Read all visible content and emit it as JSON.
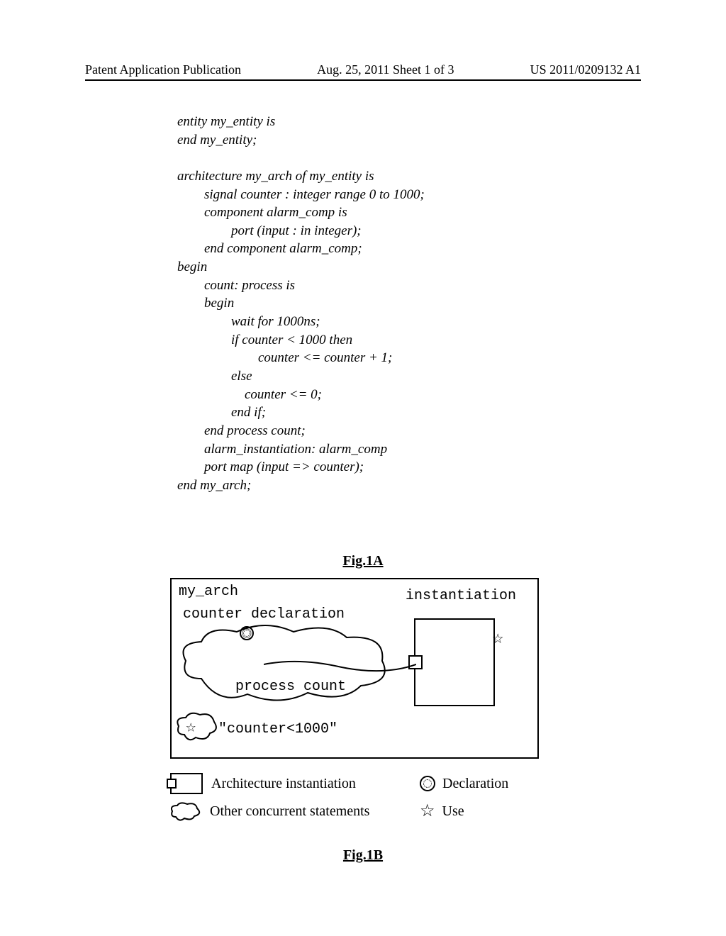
{
  "header": {
    "left": "Patent Application Publication",
    "center": "Aug. 25, 2011  Sheet 1 of 3",
    "right": "US 2011/0209132 A1"
  },
  "code": {
    "lines": [
      "entity my_entity is",
      "end my_entity;",
      "",
      "architecture my_arch of my_entity is",
      "        signal counter : integer range 0 to 1000;",
      "        component alarm_comp is",
      "                port (input : in integer);",
      "        end component alarm_comp;",
      "begin",
      "        count: process is",
      "        begin",
      "                wait for 1000ns;",
      "                if counter < 1000 then",
      "                        counter <= counter + 1;",
      "                else",
      "                    counter <= 0;",
      "                end if;",
      "        end process count;",
      "        alarm_instantiation: alarm_comp",
      "        port map (input => counter);",
      "end my_arch;"
    ]
  },
  "figures": {
    "fig1a": "Fig.1A",
    "fig1b": "Fig.1B"
  },
  "diagram": {
    "title": "my_arch",
    "instantiation_label": "instantiation",
    "counter_declaration": "counter declaration",
    "process_count": "process count",
    "counter_condition": "\"counter<1000\""
  },
  "legend": {
    "arch_instantiation": "Architecture instantiation",
    "declaration": "Declaration",
    "other_concurrent": "Other concurrent statements",
    "use": "Use"
  }
}
